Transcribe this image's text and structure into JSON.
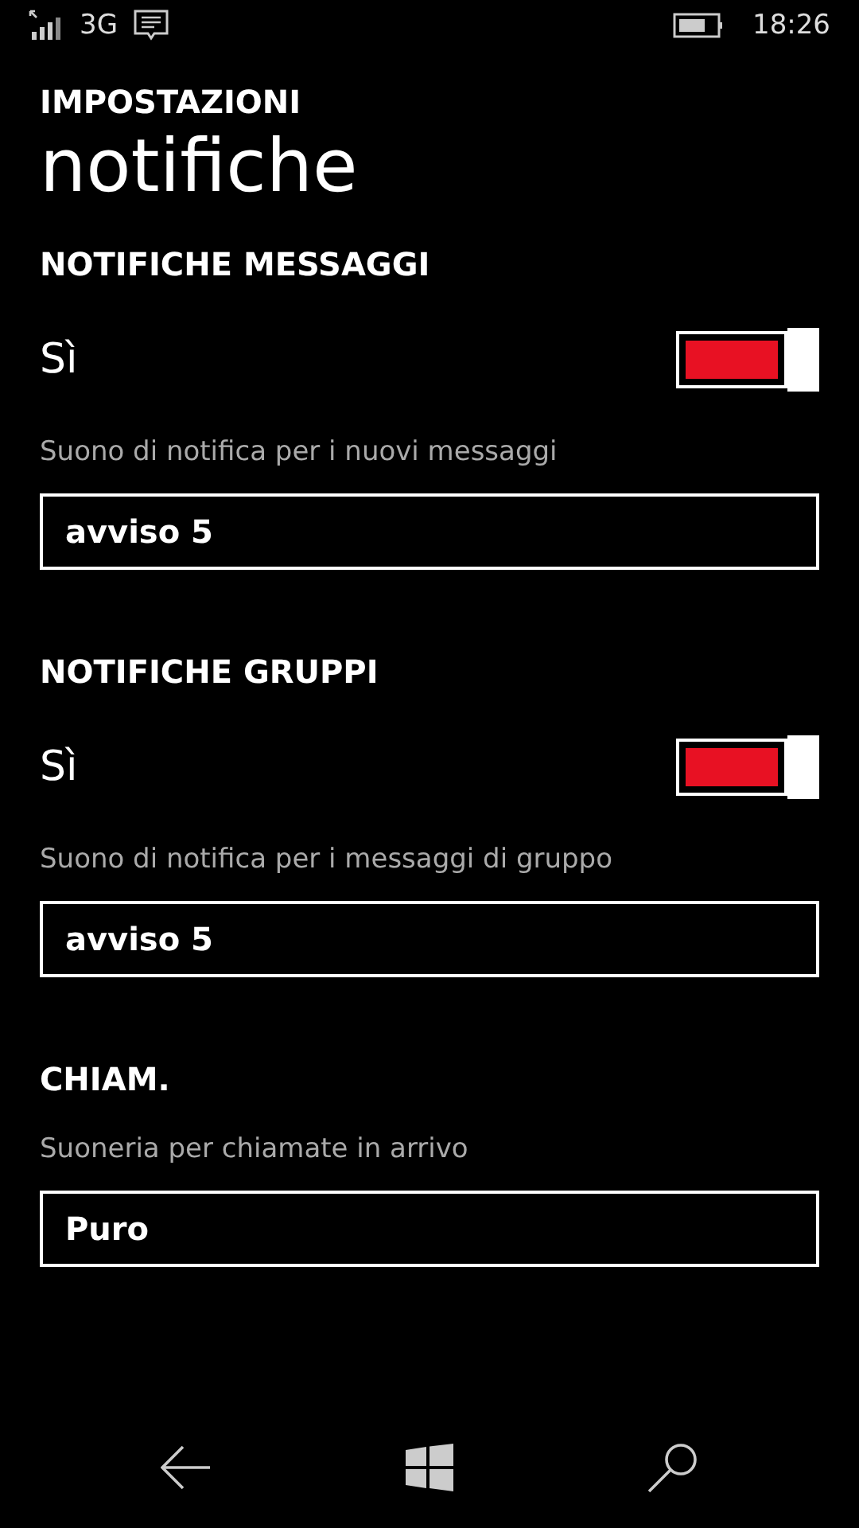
{
  "status_bar": {
    "network": "3G",
    "time": "18:26"
  },
  "header": {
    "app": "IMPOSTAZIONI",
    "title": "notifiche"
  },
  "sections": [
    {
      "heading": "NOTIFICHE MESSAGGI",
      "toggle": {
        "label": "Sì",
        "on": true
      },
      "description": "Suono di notifica per i nuovi messaggi",
      "value": "avviso 5"
    },
    {
      "heading": "NOTIFICHE GRUPPI",
      "toggle": {
        "label": "Sì",
        "on": true
      },
      "description": "Suono di notifica per i messaggi di gruppo",
      "value": "avviso 5"
    },
    {
      "heading": "CHIAM.",
      "description": "Suoneria per chiamate in arrivo",
      "value": "Puro"
    }
  ]
}
